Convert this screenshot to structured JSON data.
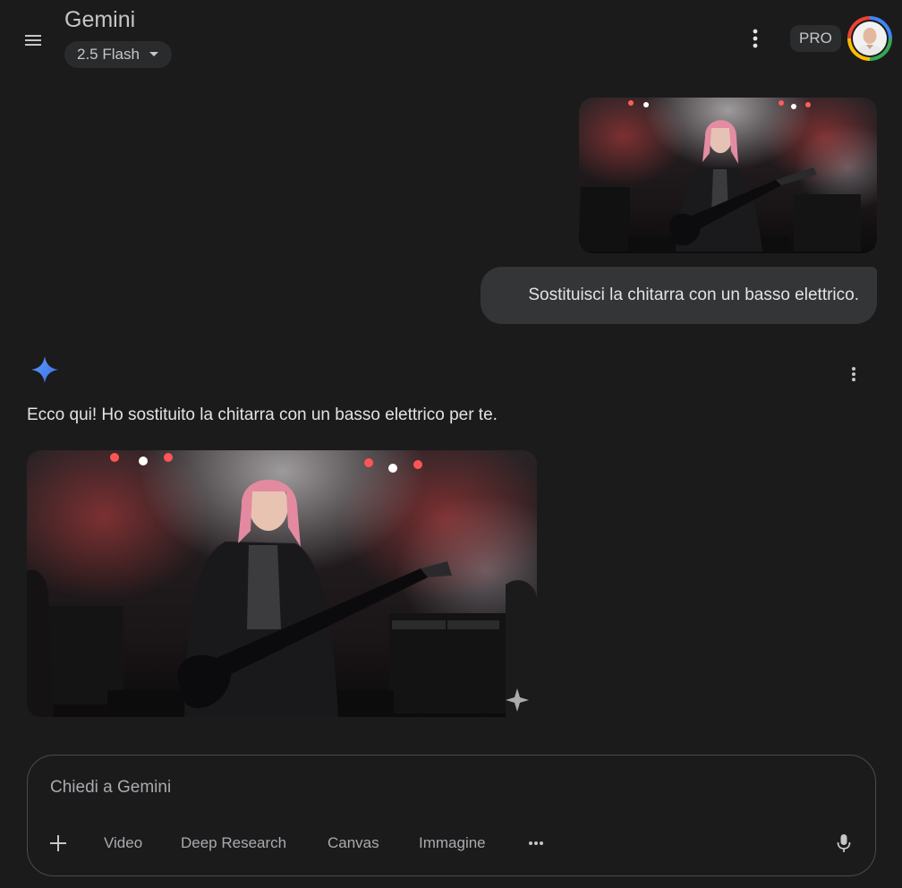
{
  "header": {
    "app_title": "Gemini",
    "model_selector": "2.5 Flash",
    "pro_badge": "PRO"
  },
  "conversation": {
    "user_message": "Sostituisci la chitarra con un basso elettrico.",
    "response_text": "Ecco qui! Ho sostituito la chitarra con un basso elettrico per te."
  },
  "input": {
    "placeholder": "Chiedi a Gemini",
    "tools": [
      "Video",
      "Deep Research",
      "Canvas",
      "Immagine"
    ]
  },
  "icons": {
    "menu": "menu-icon",
    "model_dropdown": "caret-down-icon",
    "more_top": "more-vert-icon",
    "gemini": "gemini-sparkle-icon",
    "more_response": "more-vert-icon",
    "add": "plus-icon",
    "more_tools": "more-horiz-icon",
    "mic": "microphone-icon"
  },
  "colors": {
    "background": "#1b1b1c",
    "user_bubble": "#333537",
    "sparkle_blue": "#4c8df6"
  }
}
